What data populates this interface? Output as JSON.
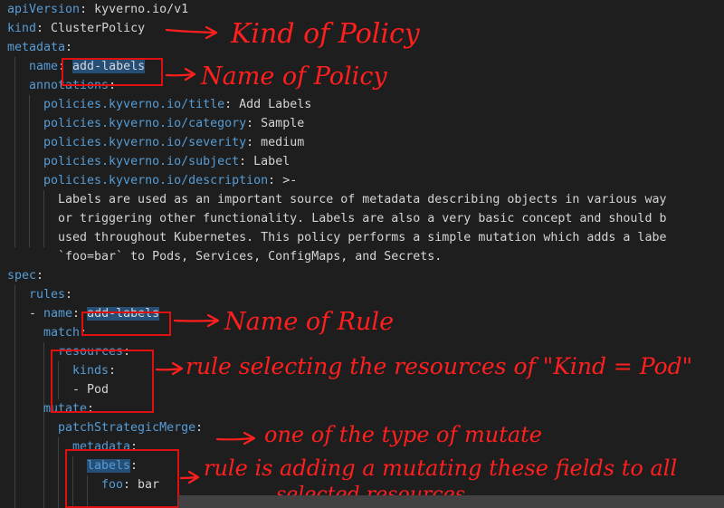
{
  "code": {
    "l1_key": "apiVersion",
    "l1_colon": ": ",
    "l1_val": "kyverno.io/v1",
    "l2_key": "kind",
    "l2_colon": ": ",
    "l2_val": "ClusterPolicy",
    "l3_key": "metadata",
    "l3_colon": ":",
    "l4_key": "name",
    "l4_colon": ": ",
    "l4_val": "add-labels",
    "l5_key": "annotations",
    "l5_colon": ":",
    "l6_key": "policies.kyverno.io/title",
    "l6_colon": ": ",
    "l6_val": "Add Labels",
    "l7_key": "policies.kyverno.io/category",
    "l7_colon": ": ",
    "l7_val": "Sample",
    "l8_key": "policies.kyverno.io/severity",
    "l8_colon": ": ",
    "l8_val": "medium",
    "l9_key": "policies.kyverno.io/subject",
    "l9_colon": ": ",
    "l9_val": "Label",
    "l10_key": "policies.kyverno.io/description",
    "l10_colon": ": ",
    "l10_val": ">-",
    "l11_text": "Labels are used as an important source of metadata describing objects in various way",
    "l12_text": "or triggering other functionality. Labels are also a very basic concept and should b",
    "l13_text": "used throughout Kubernetes. This policy performs a simple mutation which adds a labe",
    "l14_text": "`foo=bar` to Pods, Services, ConfigMaps, and Secrets.",
    "l15_key": "spec",
    "l15_colon": ":",
    "l16_key": "rules",
    "l16_colon": ":",
    "l17_dash": "- ",
    "l17_key": "name",
    "l17_colon": ": ",
    "l17_val": "add-labels",
    "l18_key": "match",
    "l18_colon": ":",
    "l19_key": "resources",
    "l19_colon": ":",
    "l20_key": "kinds",
    "l20_colon": ":",
    "l21_text": "- Pod",
    "l22_key": "mutate",
    "l22_colon": ":",
    "l23_key": "patchStrategicMerge",
    "l23_colon": ":",
    "l24_key": "metadata",
    "l24_colon": ":",
    "l25_key": "labels",
    "l25_colon": ":",
    "l26_key": "foo",
    "l26_colon": ": ",
    "l26_val": "bar"
  },
  "annotations": {
    "kind_of_policy": "Kind of Policy",
    "name_of_policy": "Name of Policy",
    "name_of_rule": "Name of Rule",
    "rule_selecting": "rule selecting the resources of \"Kind = Pod\"",
    "one_of_type": "one of the type of mutate",
    "rule_adding_1": "rule is adding a mutating these fields to all",
    "rule_adding_2": "selected resources"
  },
  "colors": {
    "background": "#1e1e1e",
    "yaml_key": "#569cd6",
    "yaml_value": "#d4d4d4",
    "highlight": "#264f78",
    "annotation_red": "#ff1f1f"
  }
}
